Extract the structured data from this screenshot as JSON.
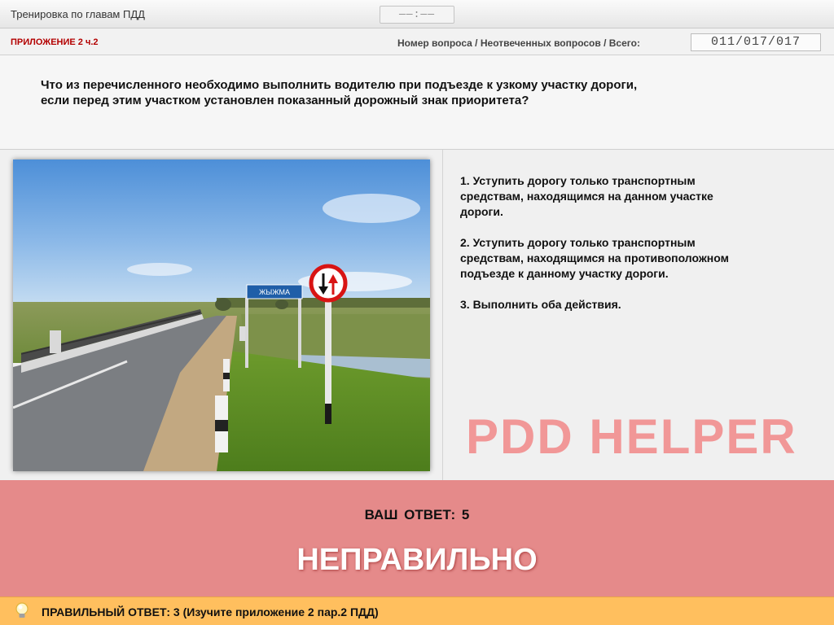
{
  "header": {
    "title": "Тренировка по главам ПДД",
    "timer": "——:——"
  },
  "subheader": {
    "appendix": "ПРИЛОЖЕНИЕ 2 ч.2",
    "question_label": "Номер вопроса / Неотвеченных вопросов / Всего:",
    "counter": "011/017/017"
  },
  "question": {
    "text_line1": "Что из перечисленного необходимо выполнить водителю при подъезде к узкому участку дороги,",
    "text_line2": "если перед этим участком установлен показанный дорожный знак приоритета?"
  },
  "image": {
    "road_sign_text": "ЖЫЖМА"
  },
  "answers": [
    {
      "line1": "1.  Уступить дорогу только транспортным",
      "line2": "средствам, находящимся на данном участке",
      "line3": "дороги."
    },
    {
      "line1": "2.  Уступить дорогу только транспортным",
      "line2": "средствам, находящимся на противоположном",
      "line3": "подъезде к данному участку дороги."
    },
    {
      "line1": "3.  Выполнить оба действия."
    }
  ],
  "watermark": "PDD HELPER",
  "result": {
    "your_answer_label": "ВАШ  ОТВЕТ:",
    "your_answer_value": "5",
    "verdict": "НЕПРАВИЛЬНО"
  },
  "footer": {
    "correct_text": "ПРАВИЛЬНЫЙ ОТВЕТ:   3   (Изучите приложение 2 пар.2 ПДД)"
  },
  "colors": {
    "result_bg": "#e58a8a",
    "footer_bg": "#ffbf5e",
    "appendix_red": "#b30000",
    "watermark": "#f28e8e"
  },
  "icons": [
    "lightbulb-icon",
    "priority-sign-icon"
  ]
}
